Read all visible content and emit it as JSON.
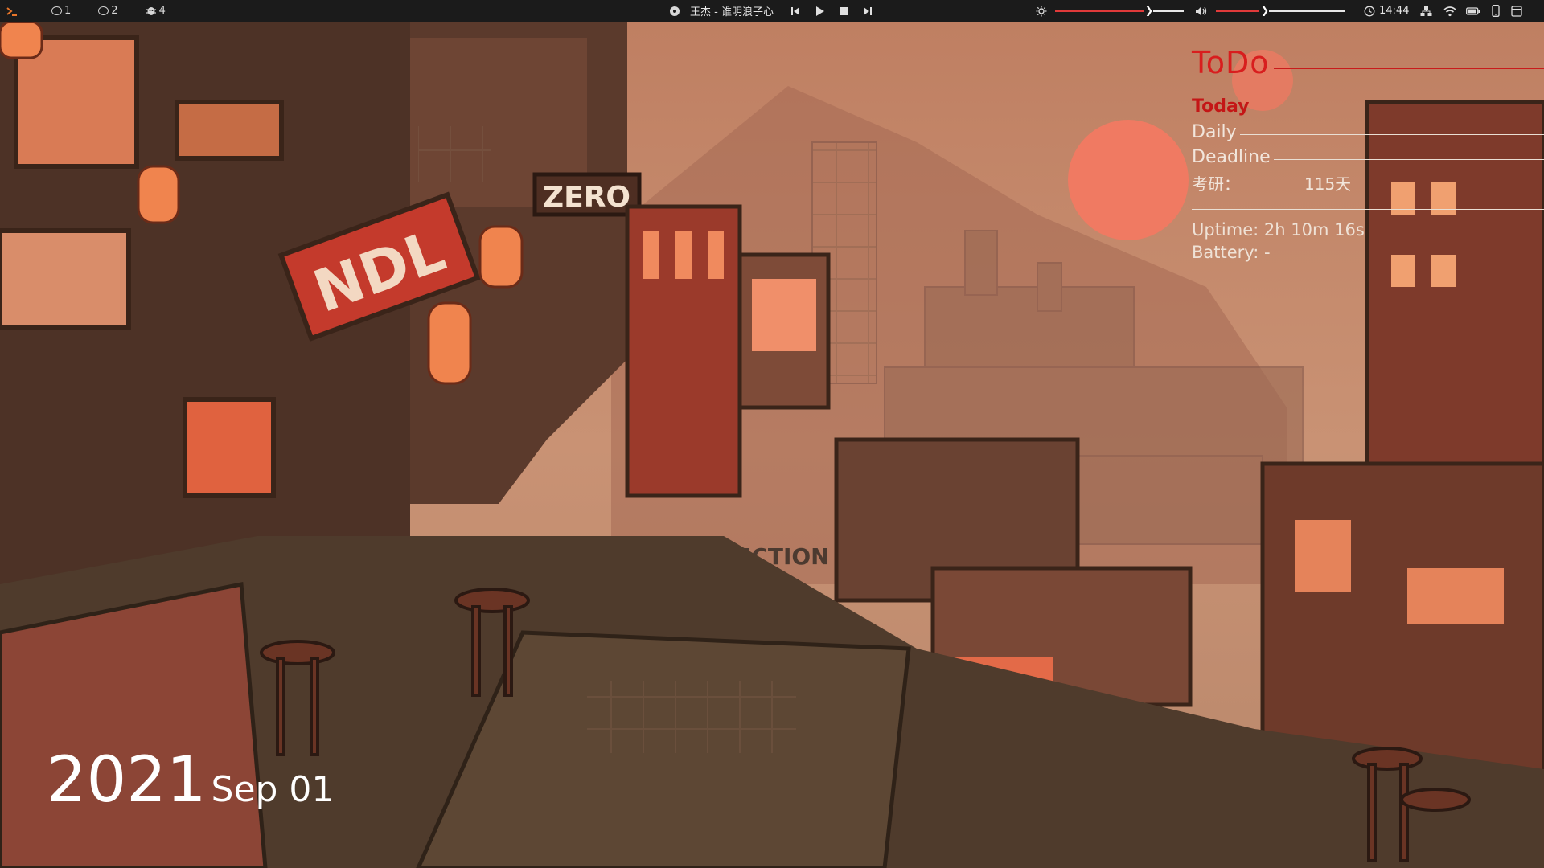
{
  "topbar": {
    "workspaces": [
      {
        "label": "1",
        "icon": "circle-icon"
      },
      {
        "label": "2",
        "icon": "circle-icon"
      },
      {
        "label": "4",
        "icon": "bug-icon"
      }
    ],
    "now_playing": "王杰 - 谁明浪子心",
    "clock": "14:44",
    "brightness_level": 0.7,
    "volume_level": 0.35
  },
  "todo": {
    "title": "ToDo",
    "sections": {
      "today": "Today",
      "daily": "Daily",
      "deadline": "Deadline"
    },
    "countdown_label": "考研：",
    "countdown_value": "115天",
    "uptime": "Uptime: 2h 10m 16s",
    "battery": "Battery: -"
  },
  "wallpaper": {
    "signs": [
      "ZERO",
      "NDL",
      "SECTION"
    ]
  },
  "date": {
    "year": "2021",
    "month_day": "Sep 01"
  },
  "colors": {
    "accent_red": "#d81e1e",
    "bar_bg": "#1b1b1b",
    "sky": "#c98b6b",
    "sun": "#f07a62"
  }
}
